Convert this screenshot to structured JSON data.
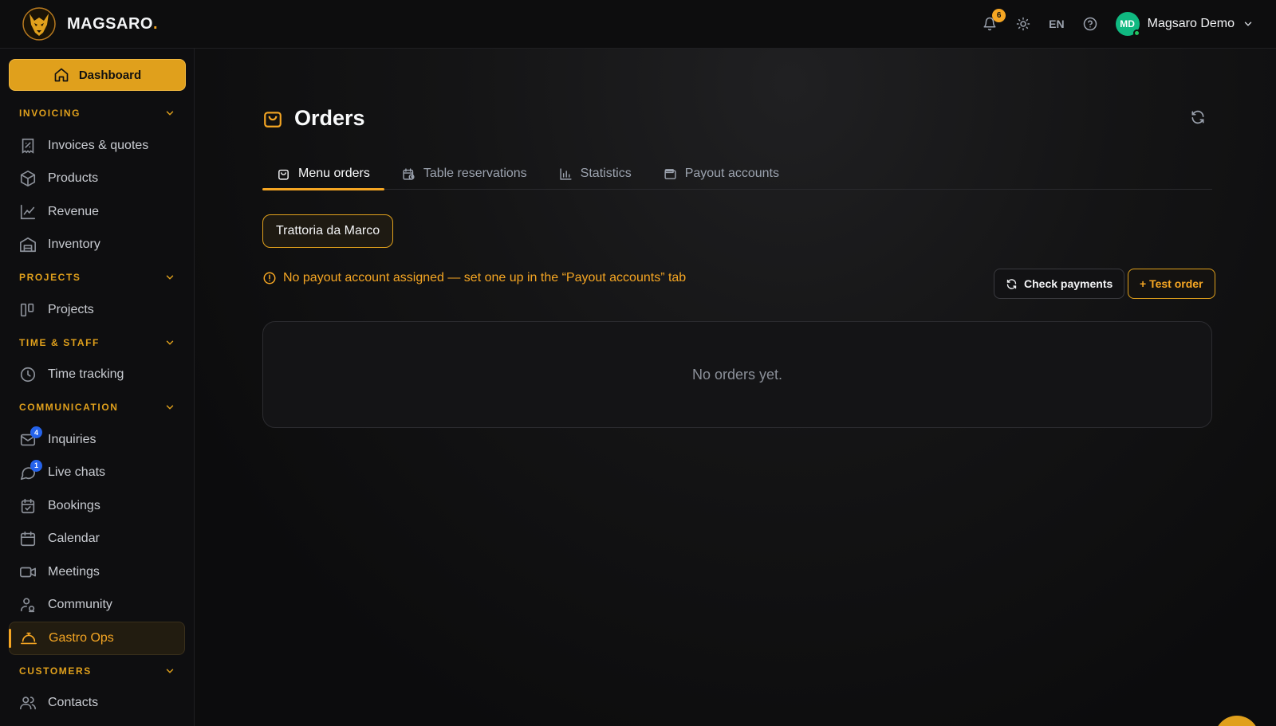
{
  "brand": {
    "name": "MAGSARO",
    "dot": "."
  },
  "topbar": {
    "notifications_count": "6",
    "language": "EN",
    "user": {
      "initials": "MD",
      "name": "Magsaro Demo"
    }
  },
  "sidebar": {
    "dashboard": "Dashboard",
    "sections": {
      "invoicing": "INVOICING",
      "projects": "PROJECTS",
      "time_staff": "TIME & STAFF",
      "communication": "COMMUNICATION",
      "customers": "CUSTOMERS"
    },
    "items": {
      "invoices": "Invoices & quotes",
      "products": "Products",
      "revenue": "Revenue",
      "inventory": "Inventory",
      "projects": "Projects",
      "time_tracking": "Time tracking",
      "inquiries": "Inquiries",
      "inquiries_badge": "4",
      "live_chats": "Live chats",
      "live_chats_badge": "1",
      "bookings": "Bookings",
      "calendar": "Calendar",
      "meetings": "Meetings",
      "community": "Community",
      "gastro_ops": "Gastro Ops",
      "contacts": "Contacts"
    }
  },
  "main": {
    "title": "Orders",
    "tabs": {
      "menu_orders": "Menu orders",
      "table_reservations": "Table reservations",
      "statistics": "Statistics",
      "payout_accounts": "Payout accounts"
    },
    "filter_chip": "Trattoria da Marco",
    "warning": "No payout account assigned — set one up in the “Payout accounts” tab",
    "check_payments": "Check payments",
    "test_order": "+ Test order",
    "empty_state": "No orders yet."
  },
  "colors": {
    "accent": "#f5a623",
    "background": "#0b0b0c",
    "online": "#22c55e",
    "badge": "#2563eb"
  }
}
